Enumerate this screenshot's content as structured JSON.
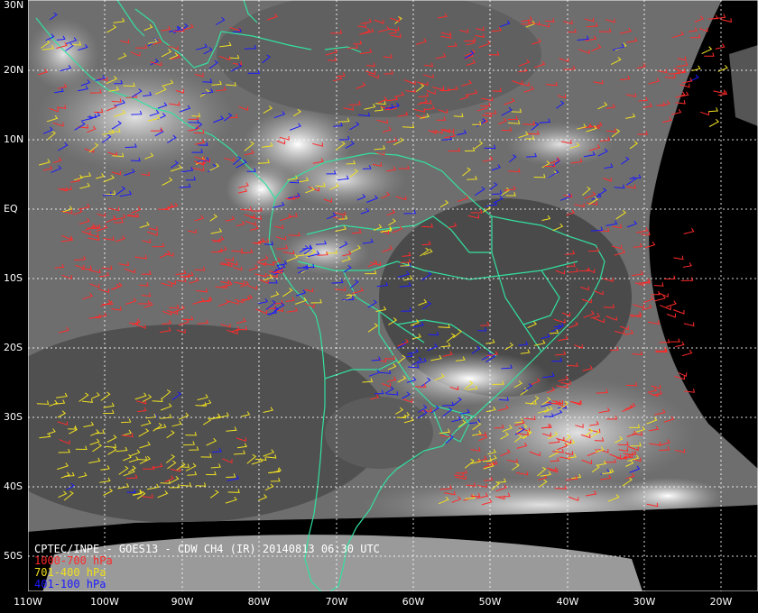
{
  "caption": "CPTEC/INPE - GOES13 - CDW CH4 (IR) 20140813 06:30 UTC",
  "legend": [
    {
      "label": "1000-700 hPa",
      "color": "#ff2a2a"
    },
    {
      "label": "701-400 hPa",
      "color": "#f0e020"
    },
    {
      "label": "401-100 hPa",
      "color": "#1a1aff"
    }
  ],
  "latitude_labels": [
    "30N",
    "20N",
    "10N",
    "EQ",
    "10S",
    "20S",
    "30S",
    "40S",
    "50S"
  ],
  "longitude_labels": [
    "110W",
    "100W",
    "90W",
    "80W",
    "70W",
    "60W",
    "50W",
    "40W",
    "30W",
    "20W"
  ],
  "colors": {
    "coastline": "#33e0a0",
    "grid": "#ffffff",
    "background": "#000000"
  }
}
